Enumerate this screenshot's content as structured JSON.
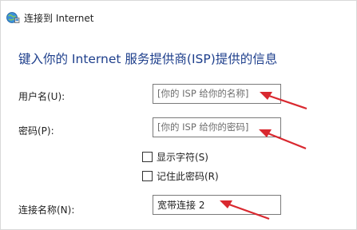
{
  "window": {
    "title": "连接到 Internet",
    "icon": "network-globe-icon"
  },
  "heading": "键入你的 Internet 服务提供商(ISP)提供的信息",
  "form": {
    "username_label": "用户名(U):",
    "username_placeholder": "[你的 ISP 给你的名称]",
    "password_label": "密码(P):",
    "password_placeholder": "[你的 ISP 给你的密码]",
    "show_chars_label": "显示字符(S)",
    "remember_password_label": "记住此密码(R)",
    "connection_name_label": "连接名称(N):",
    "connection_name_value": "宽带连接 2"
  },
  "annotations": {
    "arrow_color": "#d9282f"
  }
}
